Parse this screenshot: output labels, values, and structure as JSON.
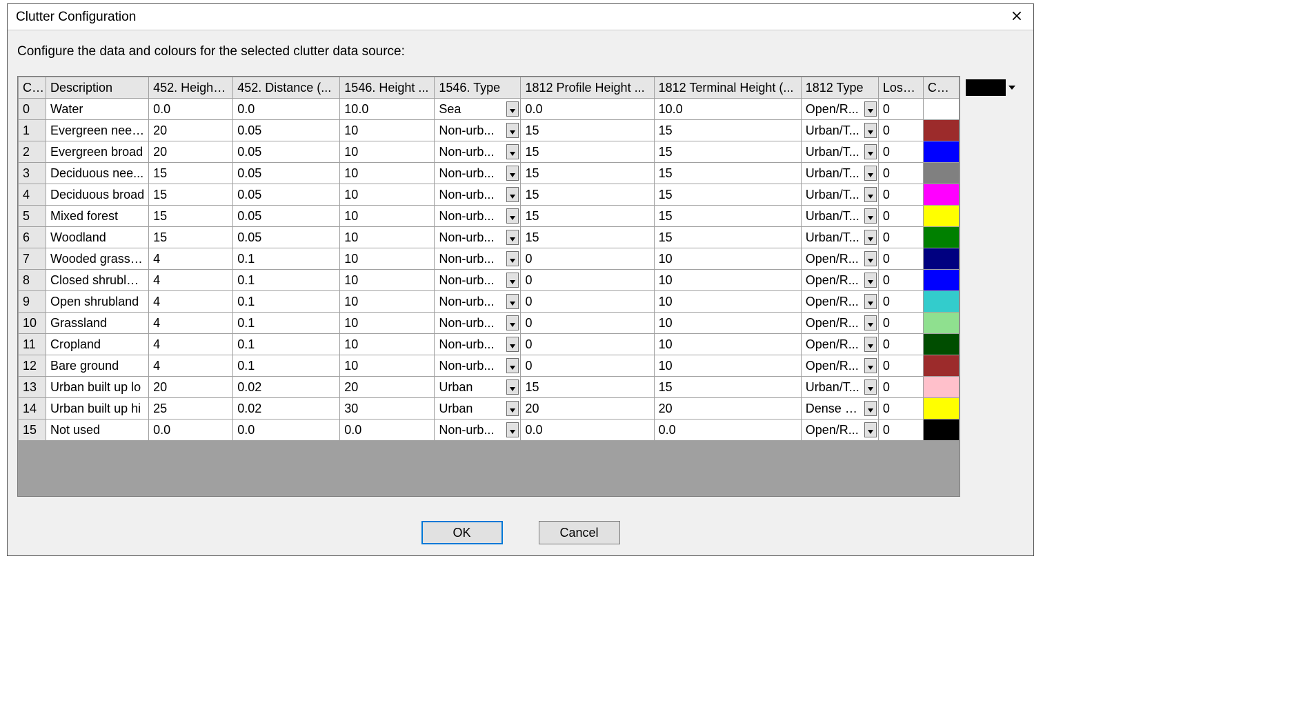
{
  "window": {
    "title": "Clutter Configuration"
  },
  "instruction": "Configure the data and colours for the selected clutter data source:",
  "picker": {
    "color": "#000000"
  },
  "buttons": {
    "ok": "OK",
    "cancel": "Cancel"
  },
  "table": {
    "headers": {
      "index": "C...",
      "description": "Description",
      "h452": "452. Height ...",
      "d452": "452. Distance (...",
      "h1546": "1546. Height ...",
      "t1546": "1546. Type",
      "ph1812": "1812 Profile Height ...",
      "th1812": "1812 Terminal Height (...",
      "ty1812": "1812 Type",
      "loss": "Loss (...",
      "col": "Col..."
    },
    "rows": [
      {
        "idx": "0",
        "desc": "Water",
        "h452": "0.0",
        "d452": "0.0",
        "h1546": "10.0",
        "t1546": "Sea",
        "ph1812": "0.0",
        "th1812": "10.0",
        "ty1812": "Open/R...",
        "loss": "0",
        "color": "#ffffff"
      },
      {
        "idx": "1",
        "desc": "Evergreen need...",
        "h452": "20",
        "d452": "0.05",
        "h1546": "10",
        "t1546": "Non-urb...",
        "ph1812": "15",
        "th1812": "15",
        "ty1812": "Urban/T...",
        "loss": "0",
        "color": "#9c2b2b"
      },
      {
        "idx": "2",
        "desc": "Evergreen broad",
        "h452": "20",
        "d452": "0.05",
        "h1546": "10",
        "t1546": "Non-urb...",
        "ph1812": "15",
        "th1812": "15",
        "ty1812": "Urban/T...",
        "loss": "0",
        "color": "#0000ff"
      },
      {
        "idx": "3",
        "desc": "Deciduous nee...",
        "h452": "15",
        "d452": "0.05",
        "h1546": "10",
        "t1546": "Non-urb...",
        "ph1812": "15",
        "th1812": "15",
        "ty1812": "Urban/T...",
        "loss": "0",
        "color": "#808080"
      },
      {
        "idx": "4",
        "desc": "Deciduous broad",
        "h452": "15",
        "d452": "0.05",
        "h1546": "10",
        "t1546": "Non-urb...",
        "ph1812": "15",
        "th1812": "15",
        "ty1812": "Urban/T...",
        "loss": "0",
        "color": "#ff00ff"
      },
      {
        "idx": "5",
        "desc": "Mixed forest",
        "h452": "15",
        "d452": "0.05",
        "h1546": "10",
        "t1546": "Non-urb...",
        "ph1812": "15",
        "th1812": "15",
        "ty1812": "Urban/T...",
        "loss": "0",
        "color": "#ffff00"
      },
      {
        "idx": "6",
        "desc": "Woodland",
        "h452": "15",
        "d452": "0.05",
        "h1546": "10",
        "t1546": "Non-urb...",
        "ph1812": "15",
        "th1812": "15",
        "ty1812": "Urban/T...",
        "loss": "0",
        "color": "#008000"
      },
      {
        "idx": "7",
        "desc": "Wooded grassla...",
        "h452": "4",
        "d452": "0.1",
        "h1546": "10",
        "t1546": "Non-urb...",
        "ph1812": "0",
        "th1812": "10",
        "ty1812": "Open/R...",
        "loss": "0",
        "color": "#000080"
      },
      {
        "idx": "8",
        "desc": "Closed shrubland",
        "h452": "4",
        "d452": "0.1",
        "h1546": "10",
        "t1546": "Non-urb...",
        "ph1812": "0",
        "th1812": "10",
        "ty1812": "Open/R...",
        "loss": "0",
        "color": "#0000ff"
      },
      {
        "idx": "9",
        "desc": "Open shrubland",
        "h452": "4",
        "d452": "0.1",
        "h1546": "10",
        "t1546": "Non-urb...",
        "ph1812": "0",
        "th1812": "10",
        "ty1812": "Open/R...",
        "loss": "0",
        "color": "#33cccc"
      },
      {
        "idx": "10",
        "desc": "Grassland",
        "h452": "4",
        "d452": "0.1",
        "h1546": "10",
        "t1546": "Non-urb...",
        "ph1812": "0",
        "th1812": "10",
        "ty1812": "Open/R...",
        "loss": "0",
        "color": "#8fe08f"
      },
      {
        "idx": "11",
        "desc": "Cropland",
        "h452": "4",
        "d452": "0.1",
        "h1546": "10",
        "t1546": "Non-urb...",
        "ph1812": "0",
        "th1812": "10",
        "ty1812": "Open/R...",
        "loss": "0",
        "color": "#004d00"
      },
      {
        "idx": "12",
        "desc": "Bare ground",
        "h452": "4",
        "d452": "0.1",
        "h1546": "10",
        "t1546": "Non-urb...",
        "ph1812": "0",
        "th1812": "10",
        "ty1812": "Open/R...",
        "loss": "0",
        "color": "#9c2b2b"
      },
      {
        "idx": "13",
        "desc": "Urban built up lo",
        "h452": "20",
        "d452": "0.02",
        "h1546": "20",
        "t1546": "Urban",
        "ph1812": "15",
        "th1812": "15",
        "ty1812": "Urban/T...",
        "loss": "0",
        "color": "#ffc0cb"
      },
      {
        "idx": "14",
        "desc": "Urban built up hi",
        "h452": "25",
        "d452": "0.02",
        "h1546": "30",
        "t1546": "Urban",
        "ph1812": "20",
        "th1812": "20",
        "ty1812": "Dense U...",
        "loss": "0",
        "color": "#ffff00"
      },
      {
        "idx": "15",
        "desc": "Not used",
        "h452": "0.0",
        "d452": "0.0",
        "h1546": "0.0",
        "t1546": "Non-urb...",
        "ph1812": "0.0",
        "th1812": "0.0",
        "ty1812": "Open/R...",
        "loss": "0",
        "color": "#000000"
      }
    ]
  }
}
